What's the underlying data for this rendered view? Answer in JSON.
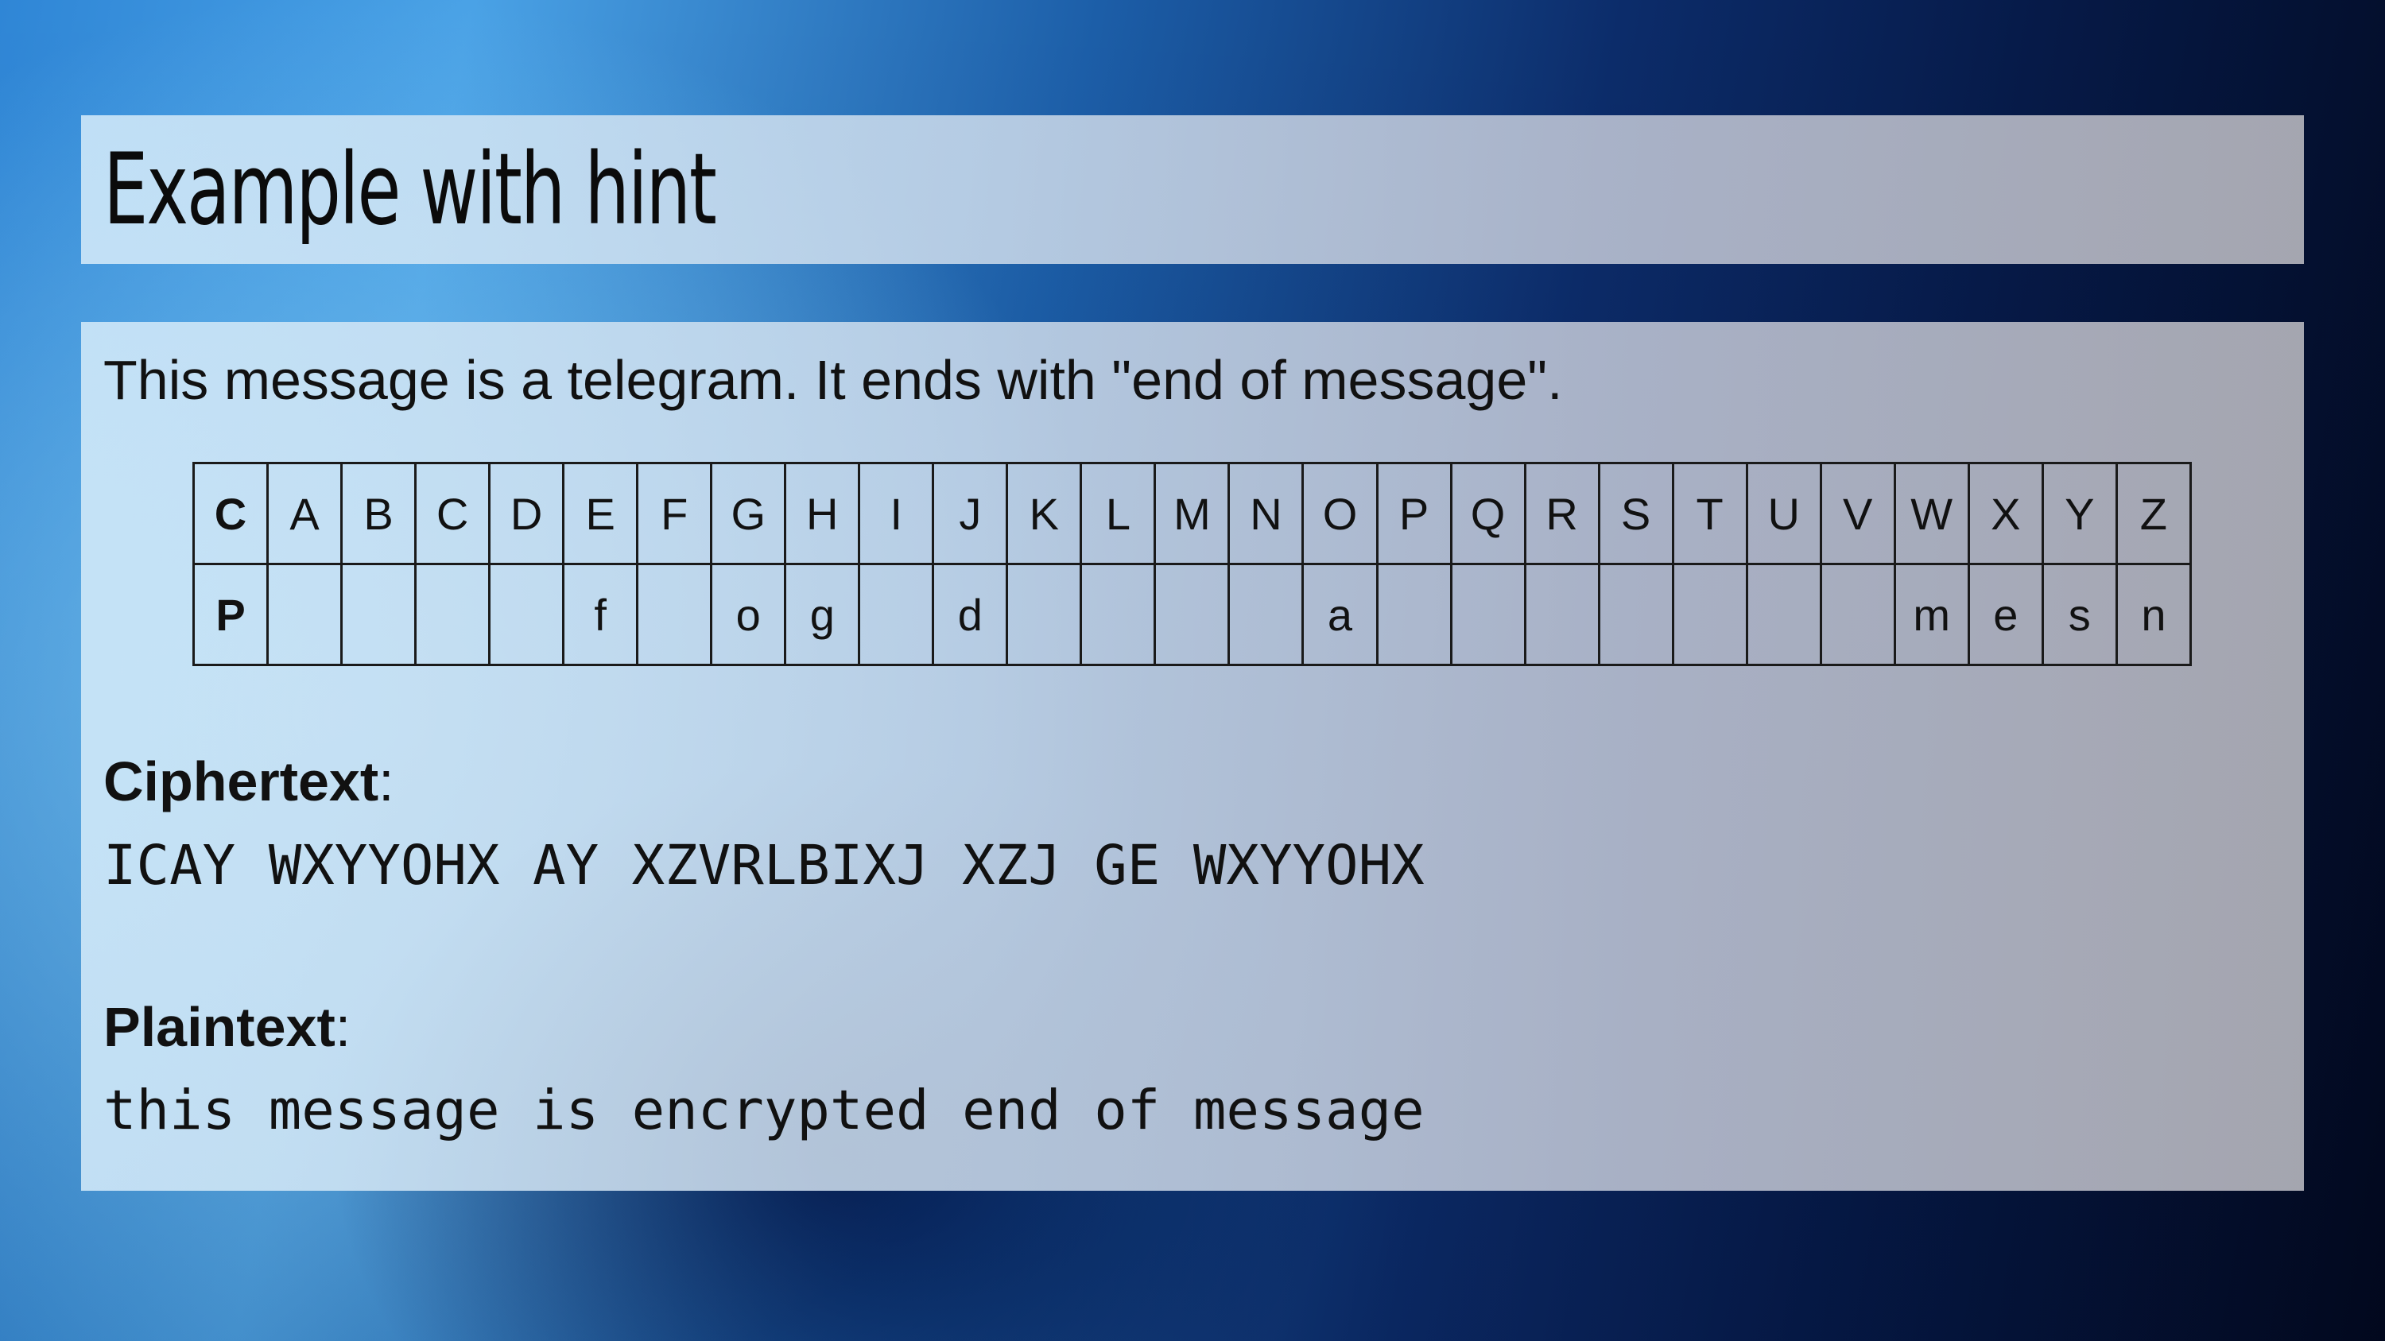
{
  "title": "Example with hint",
  "intro": "This message is a telegram. It ends with \"end of message\".",
  "table": {
    "row_headers": [
      "C",
      "P"
    ],
    "cipher_letters": [
      "A",
      "B",
      "C",
      "D",
      "E",
      "F",
      "G",
      "H",
      "I",
      "J",
      "K",
      "L",
      "M",
      "N",
      "O",
      "P",
      "Q",
      "R",
      "S",
      "T",
      "U",
      "V",
      "W",
      "X",
      "Y",
      "Z"
    ],
    "plain_letters": [
      "",
      "",
      "",
      "",
      "f",
      "",
      "o",
      "g",
      "",
      "d",
      "",
      "",
      "",
      "",
      "a",
      "",
      "",
      "",
      "",
      "",
      "",
      "",
      "m",
      "e",
      "s",
      "n"
    ]
  },
  "ciphertext": {
    "label": "Ciphertext",
    "colon": ":",
    "text": "ICAY WXYYOHX AY XZVRLBIXJ XZJ GE WXYYOHX"
  },
  "plaintext": {
    "label": "Plaintext",
    "colon": ":",
    "text": "this message is encrypted end of message"
  }
}
